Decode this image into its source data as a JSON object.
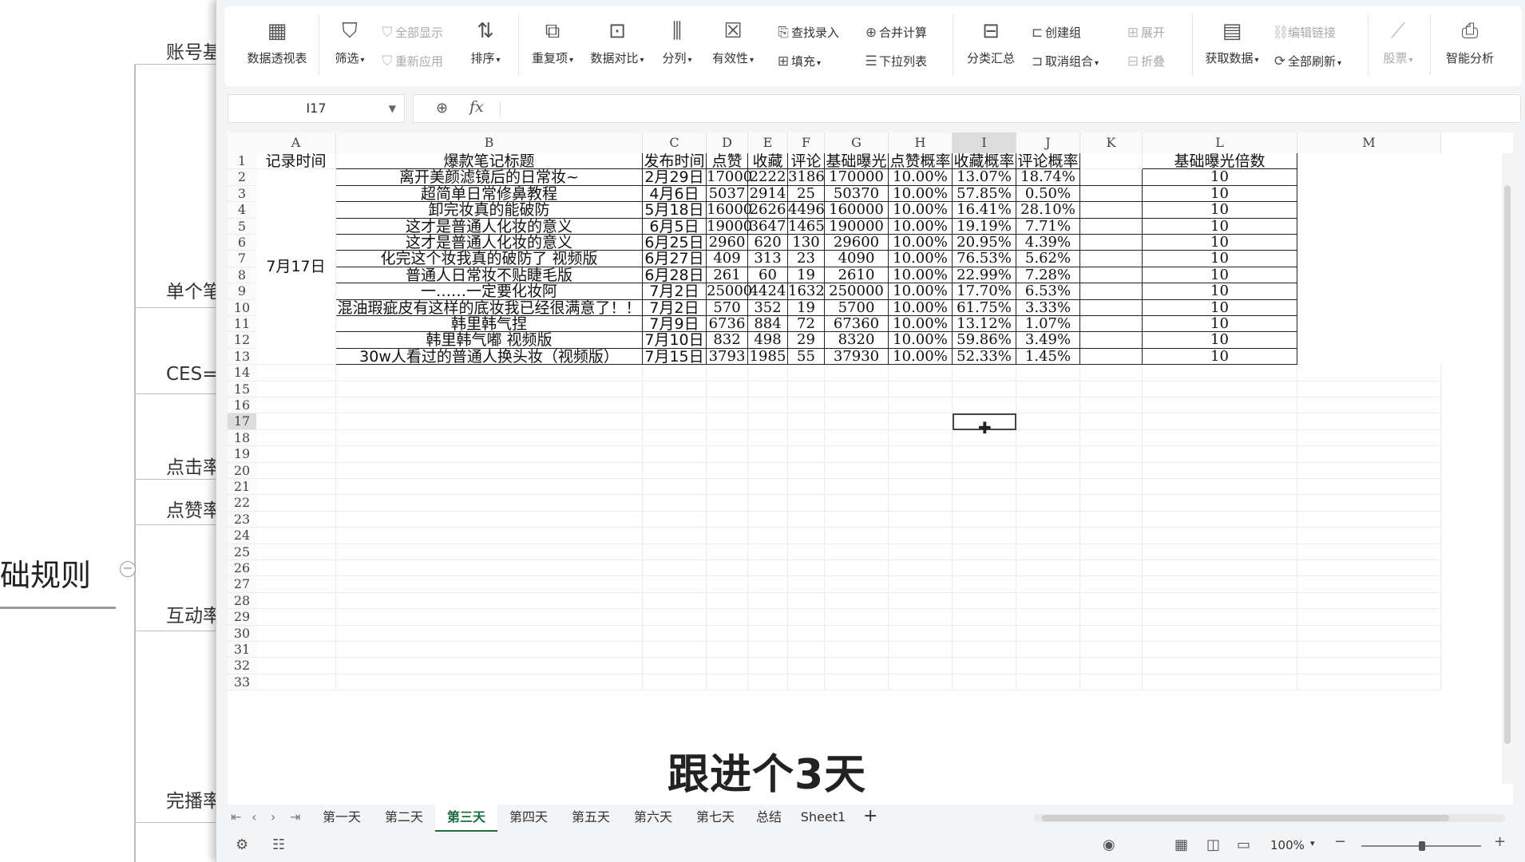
{
  "mindmap": {
    "root": "础规则",
    "collapse": "−",
    "nodes": [
      "账号基",
      "单个笔",
      "CES=",
      "点击率",
      "点赞率",
      "互动率",
      "完播率"
    ]
  },
  "ribbon": {
    "pivot": "数据透视表",
    "filter": "筛选",
    "show_all": "全部显示",
    "reapply": "重新应用",
    "sort": "排序",
    "duplicates": "重复项",
    "compare": "数据对比",
    "split": "分列",
    "validity": "有效性",
    "find_entry": "查找录入",
    "fill": "填充",
    "merge_calc": "合并计算",
    "dropdown": "下拉列表",
    "subtotal": "分类汇总",
    "create_group": "创建组",
    "ungroup": "取消组合",
    "expand": "展开",
    "collapse": "折叠",
    "get_data": "获取数据",
    "edit_links": "编辑链接",
    "refresh_all": "全部刷新",
    "stocks": "股票",
    "smart_analysis": "智能分析"
  },
  "formula_bar": {
    "name_box": "I17",
    "fx": "fx",
    "value": ""
  },
  "columns": [
    "A",
    "B",
    "C",
    "D",
    "E",
    "F",
    "G",
    "H",
    "I",
    "J",
    "K",
    "L",
    "M"
  ],
  "row_numbers": [
    "1",
    "2",
    "3",
    "4",
    "5",
    "6",
    "7",
    "8",
    "9",
    "10",
    "11",
    "12",
    "13",
    "14",
    "15",
    "16",
    "17",
    "18",
    "19",
    "20",
    "21",
    "22",
    "23",
    "24",
    "25",
    "26",
    "27",
    "28",
    "29",
    "30",
    "31",
    "32",
    "33"
  ],
  "headers": [
    "记录时间",
    "爆款笔记标题",
    "发布时间",
    "点赞",
    "收藏",
    "评论",
    "基础曝光",
    "点赞概率",
    "收藏概率",
    "评论概率",
    "",
    "基础曝光倍数"
  ],
  "record_date": "7月17日",
  "rows": [
    [
      "离开美颜滤镜后的日常妆~",
      "2月29日",
      "17000",
      "2222",
      "3186",
      "170000",
      "10.00%",
      "13.07%",
      "18.74%",
      "10"
    ],
    [
      "超简单日常修鼻教程",
      "4月6日",
      "5037",
      "2914",
      "25",
      "50370",
      "10.00%",
      "57.85%",
      "0.50%",
      "10"
    ],
    [
      "卸完妆真的能破防",
      "5月18日",
      "16000",
      "2626",
      "4496",
      "160000",
      "10.00%",
      "16.41%",
      "28.10%",
      "10"
    ],
    [
      "这才是普通人化妆的意义",
      "6月5日",
      "19000",
      "3647",
      "1465",
      "190000",
      "10.00%",
      "19.19%",
      "7.71%",
      "10"
    ],
    [
      "这才是普通人化妆的意义",
      "6月25日",
      "2960",
      "620",
      "130",
      "29600",
      "10.00%",
      "20.95%",
      "4.39%",
      "10"
    ],
    [
      "化完这个妆我真的破防了 视频版",
      "6月27日",
      "409",
      "313",
      "23",
      "4090",
      "10.00%",
      "76.53%",
      "5.62%",
      "10"
    ],
    [
      "普通人日常妆不贴睫毛版",
      "6月28日",
      "261",
      "60",
      "19",
      "2610",
      "10.00%",
      "22.99%",
      "7.28%",
      "10"
    ],
    [
      "一……一定要化妆阿",
      "7月2日",
      "25000",
      "4424",
      "1632",
      "250000",
      "10.00%",
      "17.70%",
      "6.53%",
      "10"
    ],
    [
      "混油瑕疵皮有这样的底妆我已经很满意了！！",
      "7月2日",
      "570",
      "352",
      "19",
      "5700",
      "10.00%",
      "61.75%",
      "3.33%",
      "10"
    ],
    [
      "韩里韩气捏",
      "7月9日",
      "6736",
      "884",
      "72",
      "67360",
      "10.00%",
      "13.12%",
      "1.07%",
      "10"
    ],
    [
      "韩里韩气嘟 视频版",
      "7月10日",
      "832",
      "498",
      "29",
      "8320",
      "10.00%",
      "59.86%",
      "3.49%",
      "10"
    ],
    [
      "30w人看过的普通人换头妆（视频版）",
      "7月15日",
      "3793",
      "1985",
      "55",
      "37930",
      "10.00%",
      "52.33%",
      "1.45%",
      "10"
    ]
  ],
  "sheet_tabs": [
    "第一天",
    "第二天",
    "第三天",
    "第四天",
    "第五天",
    "第六天",
    "第七天",
    "总结",
    "Sheet1"
  ],
  "active_tab": "第三天",
  "add_tab": "+",
  "status": {
    "zoom": "100%"
  },
  "subtitle": "跟进个3天"
}
